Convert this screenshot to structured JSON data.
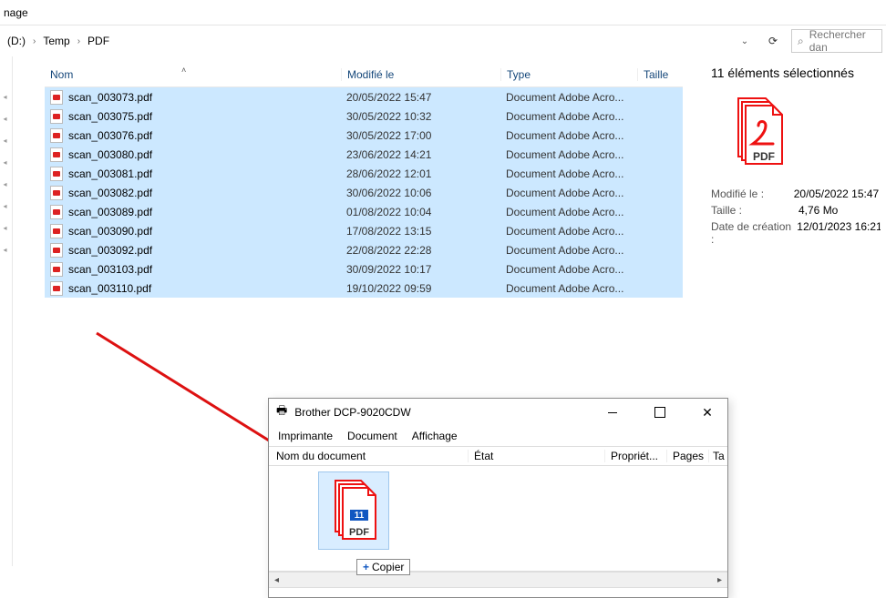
{
  "top_tab": "nage",
  "breadcrumb": {
    "parts": [
      "(D:)",
      "Temp",
      "PDF"
    ]
  },
  "search": {
    "placeholder": "Rechercher dan"
  },
  "columns": {
    "name": "Nom",
    "modified": "Modifié le",
    "type": "Type",
    "size": "Taille"
  },
  "type_trunc": "Document Adobe Acro...",
  "files": [
    {
      "name": "scan_003073.pdf",
      "modified": "20/05/2022 15:47"
    },
    {
      "name": "scan_003075.pdf",
      "modified": "30/05/2022 10:32"
    },
    {
      "name": "scan_003076.pdf",
      "modified": "30/05/2022 17:00"
    },
    {
      "name": "scan_003080.pdf",
      "modified": "23/06/2022 14:21"
    },
    {
      "name": "scan_003081.pdf",
      "modified": "28/06/2022 12:01"
    },
    {
      "name": "scan_003082.pdf",
      "modified": "30/06/2022 10:06"
    },
    {
      "name": "scan_003089.pdf",
      "modified": "01/08/2022 10:04"
    },
    {
      "name": "scan_003090.pdf",
      "modified": "17/08/2022 13:15"
    },
    {
      "name": "scan_003092.pdf",
      "modified": "22/08/2022 22:28"
    },
    {
      "name": "scan_003103.pdf",
      "modified": "30/09/2022 10:17"
    },
    {
      "name": "scan_003110.pdf",
      "modified": "19/10/2022 09:59"
    }
  ],
  "details": {
    "title": "11 éléments sélectionnés",
    "modified_label": "Modifié le :",
    "modified_value": "20/05/2022 15:47 -",
    "size_label": "Taille :",
    "size_value": "4,76 Mo",
    "created_label": "Date de création :",
    "created_value": "12/01/2023 16:21",
    "badge_text": "PDF"
  },
  "queue": {
    "title": "Brother DCP-9020CDW",
    "menu": {
      "printer": "Imprimante",
      "document": "Document",
      "view": "Affichage"
    },
    "headers": {
      "doc": "Nom du document",
      "state": "État",
      "owner": "Propriét...",
      "pages": "Pages",
      "ta": "Ta"
    },
    "drag_badge": "11",
    "drag_label": "PDF",
    "copy_tip": "Copier"
  }
}
